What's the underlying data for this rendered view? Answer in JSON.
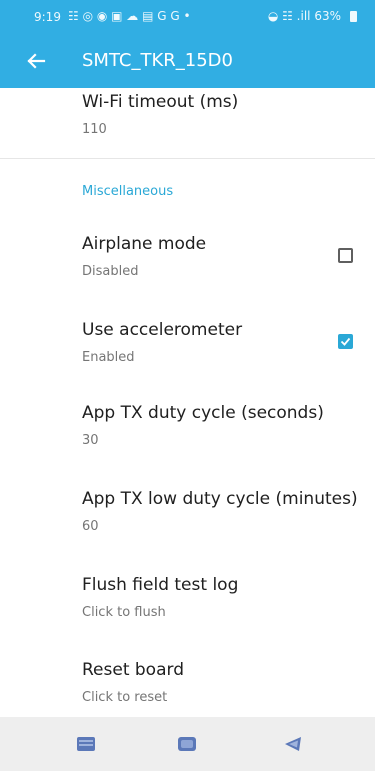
{
  "status_bar": {
    "time": "9:19",
    "left_icons": "☷ ◎ ◉ ▣ ☁ ▤ G G •",
    "right_text": "◒ ☷ .ill 63%"
  },
  "app_bar": {
    "title": "SMTC_TKR_15D0",
    "background": "#31aee3",
    "back_icon": "arrow-left-icon"
  },
  "settings": {
    "wifi_timeout": {
      "title": "Wi-Fi timeout (ms)",
      "summary": "110"
    },
    "category_misc": "Miscellaneous",
    "airplane_mode": {
      "title": "Airplane mode",
      "summary": "Disabled",
      "checked": false
    },
    "use_accelerometer": {
      "title": "Use accelerometer",
      "summary": "Enabled",
      "checked": true
    },
    "app_tx_duty": {
      "title": "App TX duty cycle (seconds)",
      "summary": "30"
    },
    "app_tx_low_duty": {
      "title": "App TX low duty cycle (minutes)",
      "summary": "60"
    },
    "flush_log": {
      "title": "Flush field test log",
      "summary": "Click to flush"
    },
    "reset_board": {
      "title": "Reset board",
      "summary": "Click to reset"
    }
  },
  "accent_color": "#2aa8d6",
  "nav_bar": {
    "recents_icon": "recents-icon",
    "home_icon": "home-icon",
    "back_icon": "back-triangle-icon"
  }
}
